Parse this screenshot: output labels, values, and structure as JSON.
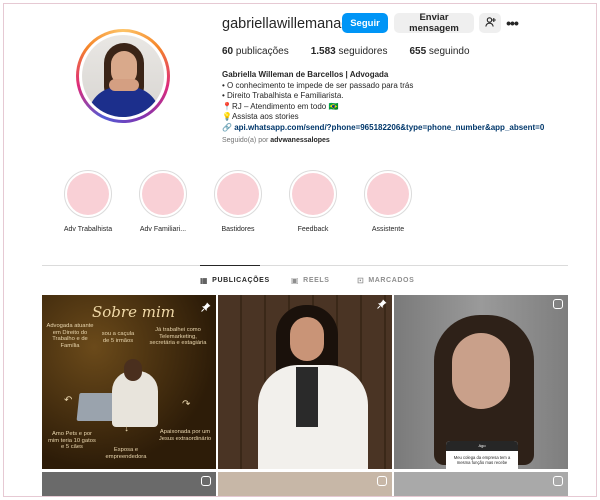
{
  "profile": {
    "username": "gabriellawillemanadv",
    "follow_label": "Seguir",
    "message_label": "Enviar mensagem",
    "suggest_icon": "person-plus-icon",
    "more_icon": "more-icon"
  },
  "stats": {
    "posts_count": "60",
    "posts_label": "publicações",
    "followers_count": "1.583",
    "followers_label": "seguidores",
    "following_count": "655",
    "following_label": "seguindo"
  },
  "bio": {
    "name": "Gabriella Willeman de Barcellos | Advogada",
    "line1": "• O conhecimento te impede de ser passado para trás",
    "line2": "• Direito Trabalhista e Familiarista.",
    "line3": "📍RJ – Atendimento em todo 🇧🇷",
    "line4": "💡Assista aos stories",
    "link": "api.whatsapp.com/send/?phone=965182206&type=phone_number&app_absent=0"
  },
  "followed_by": {
    "prefix": "Seguido(a) por",
    "user": "advwanessalopes"
  },
  "highlights": [
    {
      "label": "Adv Trabalhista"
    },
    {
      "label": "Adv Familiari..."
    },
    {
      "label": "Bastidores"
    },
    {
      "label": "Feedback"
    },
    {
      "label": "Assistente"
    }
  ],
  "tabs": {
    "posts": "PUBLICAÇÕES",
    "reels": "REELS",
    "tagged": "MARCADOS"
  },
  "posts": {
    "p1": {
      "title": "Sobre mim",
      "t1": "Advogada atuante em Direito do Trabalho e de Família",
      "t2": "sou a caçula de 5 irmãos",
      "t3": "Já trabalhei como Telemarketing, secretária e estagiária",
      "t4": "Amo Pets e por mim teria 10 gatos e 5 cães",
      "t5": "Esposa e empreendedora",
      "t6": "Apaixonada por um Jesus extraordinário"
    },
    "p3": {
      "card_head": "Ago",
      "card_text": "Meu colega da empresa tem a mesma função mas recebe"
    }
  },
  "colors": {
    "follow_button": "#0095f6",
    "highlight_fill": "#f9d0d6",
    "link": "#00376b"
  }
}
